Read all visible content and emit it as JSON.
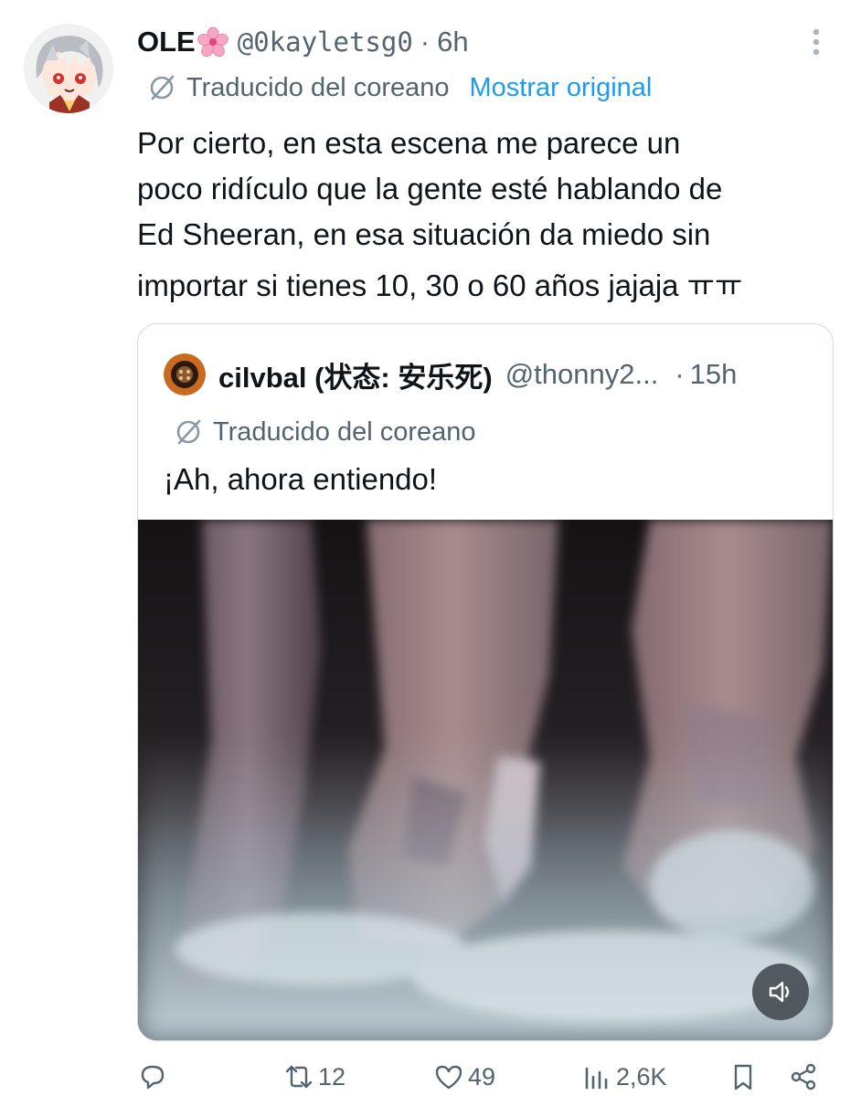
{
  "tweet": {
    "author": {
      "display_name": "OLE",
      "handle": "@0kayletsg0",
      "time": "6h"
    },
    "separator": "·",
    "translation": {
      "label": "Traducido del coreano",
      "show_original": "Mostrar original"
    },
    "body_lines": [
      "Por cierto, en esta escena me parece un",
      "poco ridículo que la gente esté hablando de",
      "Ed Sheeran, en esa situación da miedo sin",
      "importar si tienes 10, 30 o 60 años jajaja ㅠㅠ"
    ],
    "quote": {
      "display_name": "cilvbal (状态: 安乐死)",
      "handle": "@thonny2...",
      "time": "15h",
      "separator": "·",
      "translation_label": "Traducido del coreano",
      "text": "¡Ah, ahora entiendo!"
    },
    "actions": {
      "reply_count": "",
      "retweet_count": "12",
      "like_count": "49",
      "views_count": "2,6K"
    }
  },
  "colors": {
    "text_primary": "#0f1419",
    "text_secondary": "#536471",
    "link": "#1d9bf0",
    "border": "#cfd9de"
  },
  "icons": {
    "more": "more-vertical-icon",
    "translate": "translate-icon",
    "emoji": "cherry-blossom-icon",
    "volume": "volume-icon",
    "reply": "reply-icon",
    "retweet": "retweet-icon",
    "like": "heart-icon",
    "views": "views-icon",
    "bookmark": "bookmark-icon",
    "share": "share-icon"
  }
}
